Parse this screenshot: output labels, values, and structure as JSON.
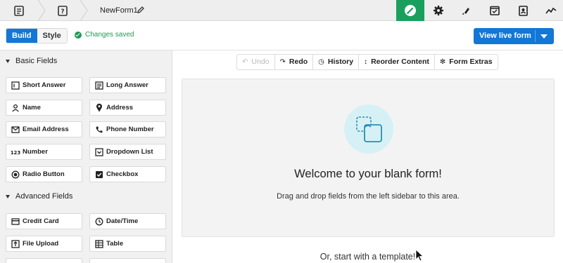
{
  "topbar": {
    "form_name": "NewForm1",
    "nav_icons": [
      "paintbrush-icon",
      "gear-icon",
      "plug-icon",
      "checkbox-list-icon",
      "badge-icon",
      "analytics-icon"
    ],
    "active_color": "#1aa05e"
  },
  "toolbar": {
    "build_label": "Build",
    "style_label": "Style",
    "status_text": "Changes saved",
    "live_button_label": "View live form"
  },
  "sidebar": {
    "basic_heading": "Basic Fields",
    "basic_fields": [
      "Short Answer",
      "Long Answer",
      "Name",
      "Address",
      "Email Address",
      "Phone Number",
      "Number",
      "Dropdown List",
      "Radio Button",
      "Checkbox"
    ],
    "advanced_heading": "Advanced Fields",
    "advanced_fields": [
      "Credit Card",
      "Date/Time",
      "File Upload",
      "Table"
    ]
  },
  "canvas": {
    "actions": [
      "Undo",
      "Redo",
      "History",
      "Reorder Content",
      "Form Extras"
    ],
    "welcome_title": "Welcome to your blank form!",
    "welcome_sub": "Drag and drop fields from the left sidebar to this area.",
    "template_text": "Or, start with a template!"
  },
  "colors": {
    "primary": "#1277d6",
    "success": "#1d9a55",
    "illustration_bg": "#d6f1f5"
  }
}
